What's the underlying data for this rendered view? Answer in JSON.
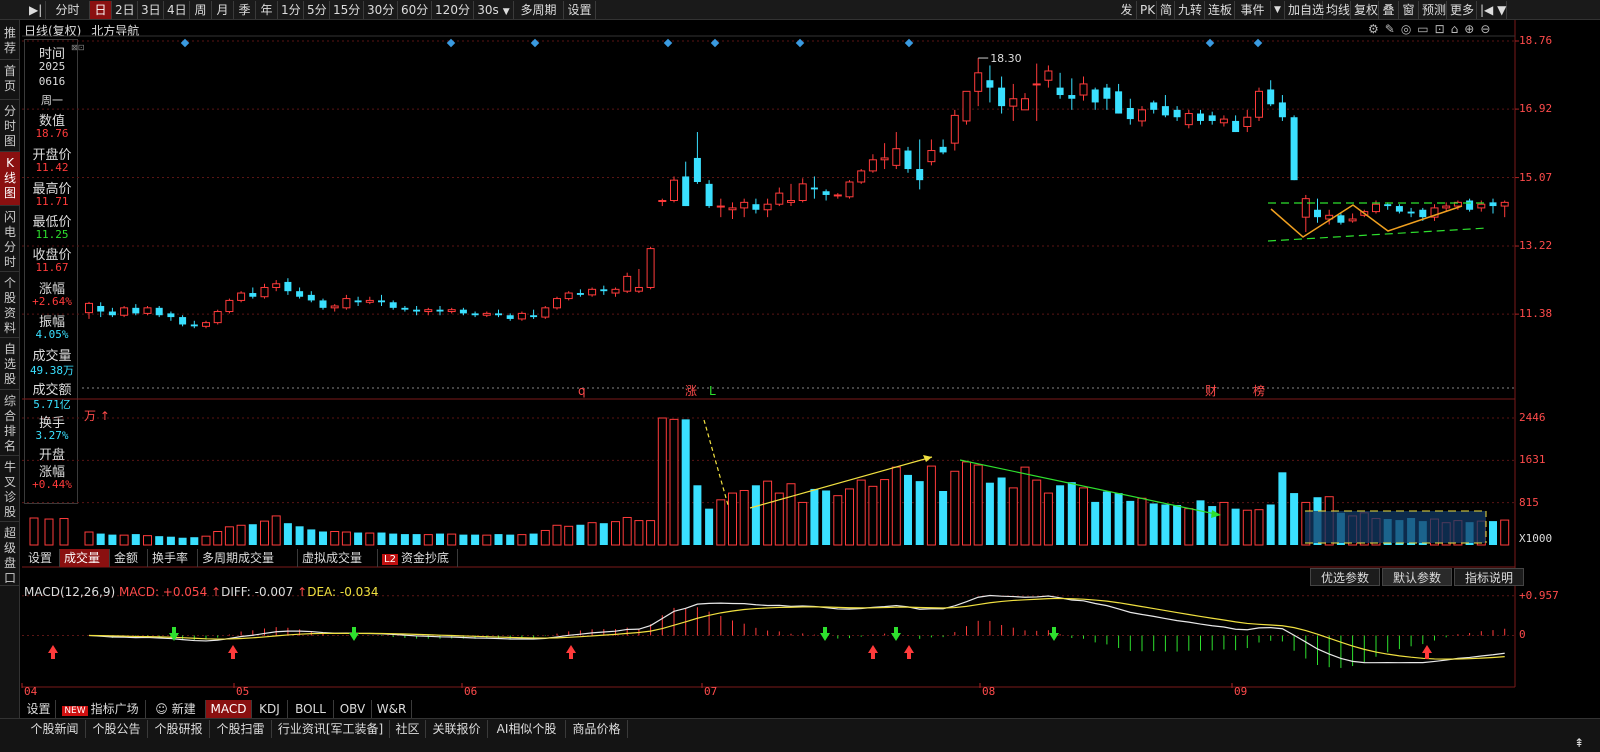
{
  "toolbar": {
    "left": [
      "分时",
      "日",
      "2日",
      "3日",
      "4日",
      "周",
      "月",
      "季",
      "年",
      "1分",
      "5分",
      "15分",
      "30分",
      "60分",
      "120分",
      "30s",
      "多周期",
      "设置"
    ],
    "active": "日",
    "right": [
      "发",
      "PK",
      "简",
      "九转",
      "连板",
      "事件",
      "加自选",
      "均线",
      "复权",
      "叠",
      "窗",
      "预测",
      "更多"
    ]
  },
  "leftnav": [
    "推荐",
    "首页",
    "分时图",
    "K线图",
    "闪电分时",
    "个股资料",
    "自选股",
    "综合排名",
    "牛叉诊股",
    "超级盘口"
  ],
  "leftnav_active": "K线图",
  "chart_header": {
    "title": "日线(复权)",
    "stock": "北方导航"
  },
  "info_panel": {
    "items": [
      {
        "label": "时间",
        "value": "2025",
        "cls": "white"
      },
      {
        "label": "",
        "value": "0616",
        "cls": "white"
      },
      {
        "label": "",
        "value": "周一",
        "cls": "white"
      },
      {
        "label": "数值",
        "value": "18.76",
        "cls": "red"
      },
      {
        "label": "开盘价",
        "value": "11.42",
        "cls": "red"
      },
      {
        "label": "最高价",
        "value": "11.71",
        "cls": "red"
      },
      {
        "label": "最低价",
        "value": "11.25",
        "cls": "green"
      },
      {
        "label": "收盘价",
        "value": "11.67",
        "cls": "red"
      },
      {
        "label": "涨幅",
        "value": "+2.64%",
        "cls": "red"
      },
      {
        "label": "振幅",
        "value": "4.05%",
        "cls": "cyan"
      },
      {
        "label": "成交量",
        "value": "49.38万",
        "cls": "cyan"
      },
      {
        "label": "成交额",
        "value": "5.71亿",
        "cls": "cyan"
      },
      {
        "label": "换手",
        "value": "3.27%",
        "cls": "cyan"
      },
      {
        "label": "开盘",
        "value": "",
        "cls": "white"
      },
      {
        "label": "涨幅",
        "value": "+0.44%",
        "cls": "red"
      }
    ]
  },
  "price_axis": [
    "18.76",
    "16.92",
    "15.07",
    "13.22",
    "11.38"
  ],
  "vol_axis": [
    "2446",
    "1631",
    "815",
    "X1000"
  ],
  "vol_unit": "万",
  "macd_axis": [
    "0.957",
    "0"
  ],
  "peak_label": "18.30",
  "event_marks": [
    "q",
    "涨",
    "L",
    "财",
    "榜"
  ],
  "vol_tabs": [
    "设置",
    "成交量",
    "金额",
    "换手率",
    "多周期成交量",
    "虚拟成交量",
    "资金抄底"
  ],
  "vol_tab_active": "成交量",
  "macd_header": {
    "name": "MACD(12,26,9)",
    "macd": "MACD: +0.054",
    "diff": "DIFF: -0.007",
    "dea": "DEA: -0.034"
  },
  "macd_buttons": [
    "优选参数",
    "默认参数",
    "指标说明"
  ],
  "macd_buttons_active": "默认参数",
  "month_labels": [
    "04",
    "05",
    "06",
    "07",
    "08",
    "09"
  ],
  "indicator_tabs": [
    "设置",
    "指标广场",
    "新建",
    "MACD",
    "KDJ",
    "BOLL",
    "OBV",
    "W&R"
  ],
  "indicator_active": "MACD",
  "indicator_new_badge": "NEW",
  "bottom_tabs": [
    "个股新闻",
    "个股公告",
    "个股研报",
    "个股扫雷",
    "行业资讯[军工装备]",
    "社区",
    "关联报价",
    "AI相似个股",
    "商品价格"
  ],
  "colors": {
    "up": "#ff3b3b",
    "down": "#3ae0ff",
    "bg": "#000000",
    "active_tab": "#8a1010"
  },
  "chart_data": {
    "type": "candlestick",
    "candles": [
      [
        11.42,
        11.71,
        11.25,
        11.67
      ],
      [
        11.6,
        11.7,
        11.3,
        11.45
      ],
      [
        11.45,
        11.55,
        11.3,
        11.35
      ],
      [
        11.35,
        11.6,
        11.3,
        11.55
      ],
      [
        11.55,
        11.65,
        11.35,
        11.4
      ],
      [
        11.4,
        11.6,
        11.35,
        11.55
      ],
      [
        11.55,
        11.6,
        11.3,
        11.35
      ],
      [
        11.4,
        11.45,
        11.2,
        11.3
      ],
      [
        11.3,
        11.35,
        11.05,
        11.1
      ],
      [
        11.1,
        11.2,
        11.0,
        11.05
      ],
      [
        11.05,
        11.2,
        11.0,
        11.15
      ],
      [
        11.15,
        11.5,
        11.1,
        11.45
      ],
      [
        11.45,
        11.8,
        11.4,
        11.75
      ],
      [
        11.75,
        12.0,
        11.7,
        11.95
      ],
      [
        11.95,
        12.1,
        11.8,
        11.85
      ],
      [
        11.85,
        12.2,
        11.8,
        12.1
      ],
      [
        12.1,
        12.3,
        12.0,
        12.2
      ],
      [
        12.25,
        12.35,
        11.9,
        12.0
      ],
      [
        12.0,
        12.1,
        11.8,
        11.85
      ],
      [
        11.9,
        12.0,
        11.7,
        11.75
      ],
      [
        11.75,
        11.8,
        11.5,
        11.55
      ],
      [
        11.55,
        11.65,
        11.45,
        11.6
      ],
      [
        11.55,
        11.9,
        11.5,
        11.8
      ],
      [
        11.75,
        11.85,
        11.6,
        11.7
      ],
      [
        11.7,
        11.85,
        11.65,
        11.75
      ],
      [
        11.75,
        11.9,
        11.6,
        11.7
      ],
      [
        11.7,
        11.75,
        11.5,
        11.55
      ],
      [
        11.55,
        11.6,
        11.45,
        11.5
      ],
      [
        11.5,
        11.6,
        11.35,
        11.45
      ],
      [
        11.45,
        11.55,
        11.35,
        11.5
      ],
      [
        11.5,
        11.6,
        11.35,
        11.45
      ],
      [
        11.45,
        11.55,
        11.4,
        11.5
      ],
      [
        11.5,
        11.55,
        11.35,
        11.4
      ],
      [
        11.4,
        11.45,
        11.3,
        11.35
      ],
      [
        11.35,
        11.45,
        11.3,
        11.4
      ],
      [
        11.4,
        11.5,
        11.3,
        11.35
      ],
      [
        11.35,
        11.4,
        11.2,
        11.25
      ],
      [
        11.25,
        11.45,
        11.2,
        11.4
      ],
      [
        11.35,
        11.5,
        11.25,
        11.3
      ],
      [
        11.3,
        11.6,
        11.25,
        11.55
      ],
      [
        11.55,
        11.85,
        11.5,
        11.8
      ],
      [
        11.8,
        12.0,
        11.75,
        11.95
      ],
      [
        11.95,
        12.05,
        11.85,
        11.9
      ],
      [
        11.9,
        12.1,
        11.85,
        12.05
      ],
      [
        12.05,
        12.15,
        11.9,
        12.0
      ],
      [
        11.95,
        12.1,
        11.85,
        12.05
      ],
      [
        12.0,
        12.5,
        11.95,
        12.4
      ],
      [
        12.0,
        12.6,
        11.95,
        12.1
      ],
      [
        12.1,
        13.2,
        12.05,
        13.15
      ],
      [
        14.45,
        14.5,
        14.3,
        14.45
      ],
      [
        14.45,
        15.1,
        14.4,
        15.0
      ],
      [
        15.1,
        15.5,
        14.3,
        14.3
      ],
      [
        15.6,
        16.3,
        14.9,
        14.95
      ],
      [
        14.9,
        15.0,
        14.25,
        14.3
      ],
      [
        14.3,
        14.5,
        14.0,
        14.3
      ],
      [
        14.2,
        14.4,
        13.95,
        14.25
      ],
      [
        14.25,
        14.5,
        14.0,
        14.4
      ],
      [
        14.35,
        14.5,
        14.1,
        14.2
      ],
      [
        14.2,
        14.5,
        14.0,
        14.35
      ],
      [
        14.35,
        14.8,
        14.3,
        14.65
      ],
      [
        14.4,
        14.9,
        14.3,
        14.45
      ],
      [
        14.45,
        15.05,
        14.4,
        14.9
      ],
      [
        14.8,
        15.1,
        14.5,
        14.75
      ],
      [
        14.7,
        14.75,
        14.45,
        14.6
      ],
      [
        14.6,
        14.65,
        14.5,
        14.6
      ],
      [
        14.55,
        15.0,
        14.5,
        14.95
      ],
      [
        14.95,
        15.3,
        14.9,
        15.25
      ],
      [
        15.25,
        15.7,
        15.2,
        15.55
      ],
      [
        15.55,
        16.0,
        15.3,
        15.6
      ],
      [
        15.4,
        16.3,
        15.3,
        15.85
      ],
      [
        15.8,
        15.9,
        15.2,
        15.3
      ],
      [
        15.3,
        16.1,
        14.75,
        15.0
      ],
      [
        15.5,
        16.1,
        15.4,
        15.8
      ],
      [
        15.9,
        16.1,
        15.7,
        15.75
      ],
      [
        16.0,
        16.9,
        15.8,
        16.75
      ],
      [
        16.6,
        17.4,
        16.5,
        17.4
      ],
      [
        17.4,
        18.3,
        17.0,
        17.9
      ],
      [
        17.7,
        18.1,
        17.1,
        17.5
      ],
      [
        17.5,
        17.8,
        16.8,
        17.0
      ],
      [
        17.0,
        17.6,
        16.6,
        17.2
      ],
      [
        16.9,
        17.35,
        16.9,
        17.2
      ],
      [
        17.6,
        18.15,
        16.6,
        17.6
      ],
      [
        17.7,
        18.1,
        17.5,
        17.95
      ],
      [
        17.5,
        17.9,
        17.2,
        17.3
      ],
      [
        17.3,
        17.75,
        16.9,
        17.2
      ],
      [
        17.3,
        17.8,
        17.15,
        17.6
      ],
      [
        17.45,
        17.5,
        16.9,
        17.1
      ],
      [
        17.5,
        17.6,
        16.9,
        17.2
      ],
      [
        17.4,
        17.6,
        16.8,
        16.8
      ],
      [
        16.95,
        17.2,
        16.5,
        16.65
      ],
      [
        16.6,
        17.0,
        16.45,
        16.9
      ],
      [
        17.1,
        17.15,
        16.8,
        16.9
      ],
      [
        17.0,
        17.3,
        16.7,
        16.75
      ],
      [
        16.9,
        17.0,
        16.6,
        16.7
      ],
      [
        16.5,
        16.9,
        16.4,
        16.8
      ],
      [
        16.8,
        16.9,
        16.5,
        16.6
      ],
      [
        16.75,
        16.85,
        16.5,
        16.6
      ],
      [
        16.55,
        16.75,
        16.45,
        16.65
      ],
      [
        16.6,
        16.75,
        16.3,
        16.3
      ],
      [
        16.45,
        16.9,
        16.3,
        16.7
      ],
      [
        16.7,
        17.5,
        16.6,
        17.4
      ],
      [
        17.45,
        17.7,
        17.0,
        17.05
      ],
      [
        17.1,
        17.3,
        16.6,
        16.7
      ],
      [
        16.7,
        16.75,
        15.0,
        15.0
      ],
      [
        14.0,
        14.6,
        13.6,
        14.5
      ],
      [
        14.2,
        14.5,
        13.85,
        14.0
      ],
      [
        13.95,
        14.2,
        13.8,
        14.05
      ],
      [
        14.05,
        14.1,
        13.8,
        13.85
      ],
      [
        13.9,
        14.1,
        13.85,
        13.95
      ],
      [
        14.05,
        14.2,
        14.0,
        14.15
      ],
      [
        14.15,
        14.45,
        14.1,
        14.35
      ],
      [
        14.35,
        14.4,
        14.2,
        14.3
      ],
      [
        14.3,
        14.35,
        14.1,
        14.15
      ],
      [
        14.15,
        14.25,
        14.0,
        14.1
      ],
      [
        14.2,
        14.25,
        13.9,
        14.0
      ],
      [
        14.0,
        14.35,
        13.9,
        14.25
      ],
      [
        14.25,
        14.4,
        14.15,
        14.3
      ],
      [
        14.3,
        14.45,
        14.2,
        14.4
      ],
      [
        14.45,
        14.5,
        14.15,
        14.2
      ],
      [
        14.25,
        14.45,
        14.15,
        14.35
      ],
      [
        14.4,
        14.5,
        14.1,
        14.3
      ],
      [
        14.3,
        14.45,
        14.0,
        14.4
      ]
    ],
    "volumes": [
      250,
      220,
      200,
      190,
      210,
      180,
      170,
      160,
      140,
      150,
      170,
      260,
      350,
      380,
      400,
      460,
      560,
      420,
      360,
      300,
      260,
      260,
      250,
      240,
      230,
      240,
      220,
      210,
      210,
      200,
      220,
      210,
      200,
      200,
      190,
      210,
      200,
      200,
      220,
      280,
      380,
      360,
      390,
      430,
      420,
      450,
      530,
      470,
      470,
      2446,
      2420,
      2420,
      1150,
      700,
      870,
      1000,
      1050,
      1150,
      1230,
      1000,
      1180,
      820,
      1080,
      1050,
      950,
      1080,
      1250,
      1130,
      1260,
      1500,
      1350,
      1230,
      1520,
      1040,
      1420,
      1600,
      1540,
      1200,
      1300,
      1100,
      1500,
      1250,
      1000,
      1150,
      1210,
      1100,
      830,
      1030,
      1000,
      850,
      900,
      800,
      780,
      770,
      700,
      860,
      750,
      820,
      700,
      670,
      680,
      780,
      1400,
      1000,
      820,
      920,
      930,
      620,
      560,
      620,
      510,
      500,
      480,
      520,
      460,
      500,
      430,
      470,
      440,
      460,
      460,
      480,
      500,
      430,
      400,
      500,
      430
    ],
    "volume_unit": "X1000",
    "price_range": [
      9.6,
      18.76
    ],
    "macd_range": [
      -1.05,
      1.0
    ],
    "months": [
      "04",
      "05",
      "06",
      "07",
      "08",
      "09"
    ]
  }
}
